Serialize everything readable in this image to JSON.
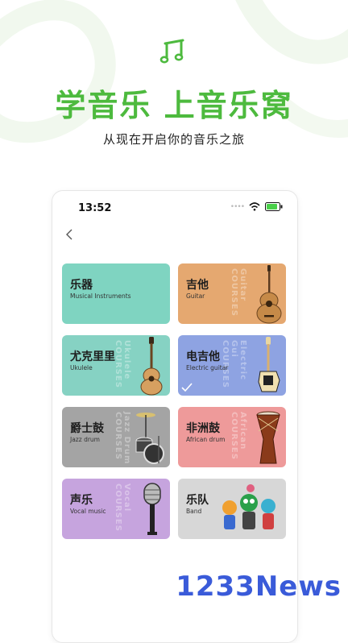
{
  "header": {
    "headline": "学音乐 上音乐窝",
    "subline": "从现在开启你的音乐之旅"
  },
  "phone": {
    "time": "13:52"
  },
  "watermark": "COURSES",
  "categories": [
    {
      "zh": "乐器",
      "en": "Musical Instruments",
      "color": "#7fd4c1",
      "wm": "",
      "icon": "instruments-illustration"
    },
    {
      "zh": "吉他",
      "en": "Guitar",
      "color": "#e5a870",
      "wm": "Guitar",
      "icon": "acoustic-guitar-icon"
    },
    {
      "zh": "尤克里里",
      "en": "Ukulele",
      "color": "#86d2c3",
      "wm": "Ukulele",
      "icon": "ukulele-icon"
    },
    {
      "zh": "电吉他",
      "en": "Electric guitar",
      "color": "#8ea3e2",
      "wm": "Electric Gui",
      "icon": "electric-guitar-icon"
    },
    {
      "zh": "爵士鼓",
      "en": "Jazz drum",
      "color": "#a4a4a4",
      "wm": "Jazz Drum",
      "icon": "drum-kit-icon"
    },
    {
      "zh": "非洲鼓",
      "en": "African drum",
      "color": "#ee9a9a",
      "wm": "African",
      "icon": "djembe-icon"
    },
    {
      "zh": "声乐",
      "en": "Vocal music",
      "color": "#c6a4de",
      "wm": "Vocal",
      "icon": "microphone-icon"
    },
    {
      "zh": "乐队",
      "en": "Band",
      "color": "#d7d7d7",
      "wm": "",
      "icon": "band-characters-illustration"
    }
  ],
  "brand": "1233News",
  "colors": {
    "accent": "#4dba3e",
    "brand": "#3a5bd9"
  }
}
